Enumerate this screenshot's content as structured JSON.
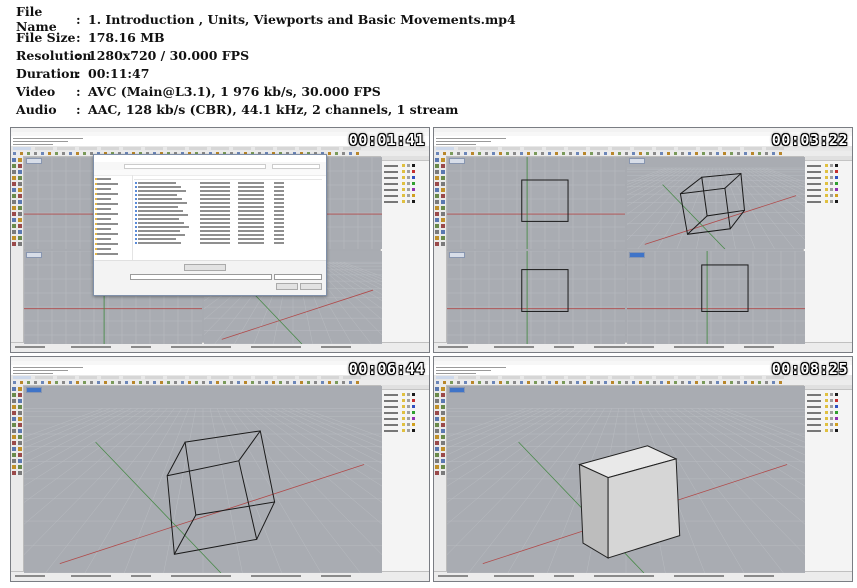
{
  "media_info": {
    "rows": [
      {
        "label": "File Name",
        "value": "1. Introduction , Units, Viewports and Basic Movements.mp4"
      },
      {
        "label": "File Size",
        "value": "178.16 MB"
      },
      {
        "label": "Resolution",
        "value": "1280x720 / 30.000 FPS"
      },
      {
        "label": "Duration",
        "value": "00:11:47"
      },
      {
        "label": "Video",
        "value": "AVC (Main@L3.1), 1 976 kb/s, 30.000 FPS"
      },
      {
        "label": "Audio",
        "value": "AAC, 128 kb/s (CBR), 44.1 kHz, 2 channels, 1 stream"
      }
    ],
    "separator": ":"
  },
  "thumbnails": [
    {
      "timestamp": "00:01:41",
      "scene": "file-dialog-four-viewports"
    },
    {
      "timestamp": "00:03:22",
      "scene": "four-viewports-box"
    },
    {
      "timestamp": "00:06:44",
      "scene": "perspective-wireframe-box"
    },
    {
      "timestamp": "00:08:25",
      "scene": "perspective-shaded-box"
    }
  ],
  "colors": {
    "viewport_bg": "#a9acb2",
    "grid": "#b9bcc1",
    "axis_x": "#b04a4a",
    "axis_y": "#4a8a4a",
    "box_wire": "#1a1a1a",
    "box_shaded_top": "#e9e9e9",
    "box_shaded_front": "#d6d6d6",
    "box_shaded_side": "#bdbdbd",
    "timestamp": "#ffffff"
  }
}
